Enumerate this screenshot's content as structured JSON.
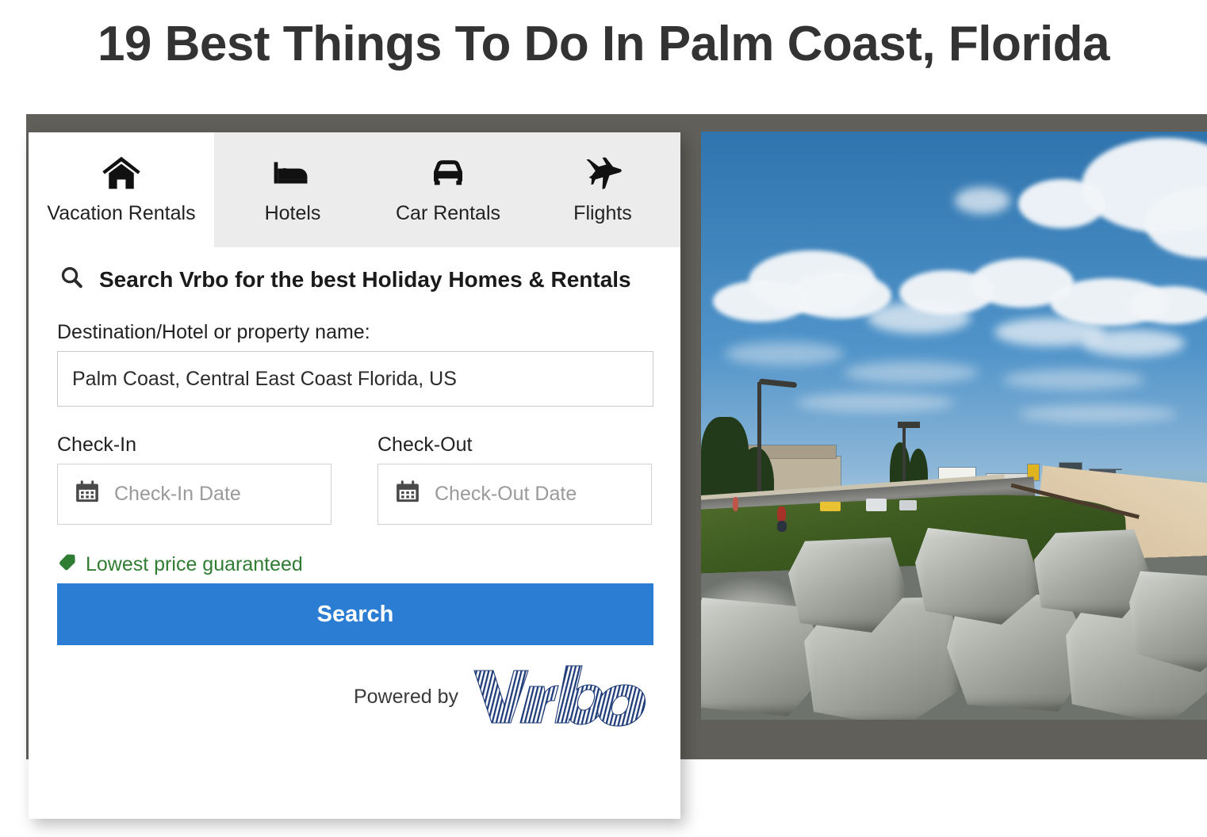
{
  "page": {
    "title": "19 Best Things To Do In Palm Coast, Florida"
  },
  "widget": {
    "tabs": [
      {
        "label": "Vacation Rentals",
        "icon": "house-icon",
        "active": true
      },
      {
        "label": "Hotels",
        "icon": "bed-icon",
        "active": false
      },
      {
        "label": "Car Rentals",
        "icon": "car-icon",
        "active": false
      },
      {
        "label": "Flights",
        "icon": "airplane-icon",
        "active": false
      }
    ],
    "search_heading": "Search Vrbo for the best Holiday Homes & Rentals",
    "destination": {
      "label": "Destination/Hotel or property name:",
      "value": "Palm Coast, Central East Coast Florida, US",
      "placeholder": "Destination/Hotel or property name"
    },
    "check_in": {
      "label": "Check-In",
      "placeholder": "Check-In Date",
      "value": ""
    },
    "check_out": {
      "label": "Check-Out",
      "placeholder": "Check-Out Date",
      "value": ""
    },
    "guarantee_text": "Lowest price guaranteed",
    "search_button_label": "Search",
    "powered_by_text": "Powered by",
    "brand_name": "Vrbo"
  },
  "colors": {
    "accent_blue": "#2b7cd3",
    "guarantee_green": "#2f7d32",
    "backdrop_gray": "#605f59",
    "tab_inactive_gray": "#ececec",
    "brand_navy": "#1f3c79"
  },
  "photo": {
    "alt": "Rocky seawall with granite boulders beside a coastal road and sandy beach under a blue sky with cumulus clouds"
  }
}
